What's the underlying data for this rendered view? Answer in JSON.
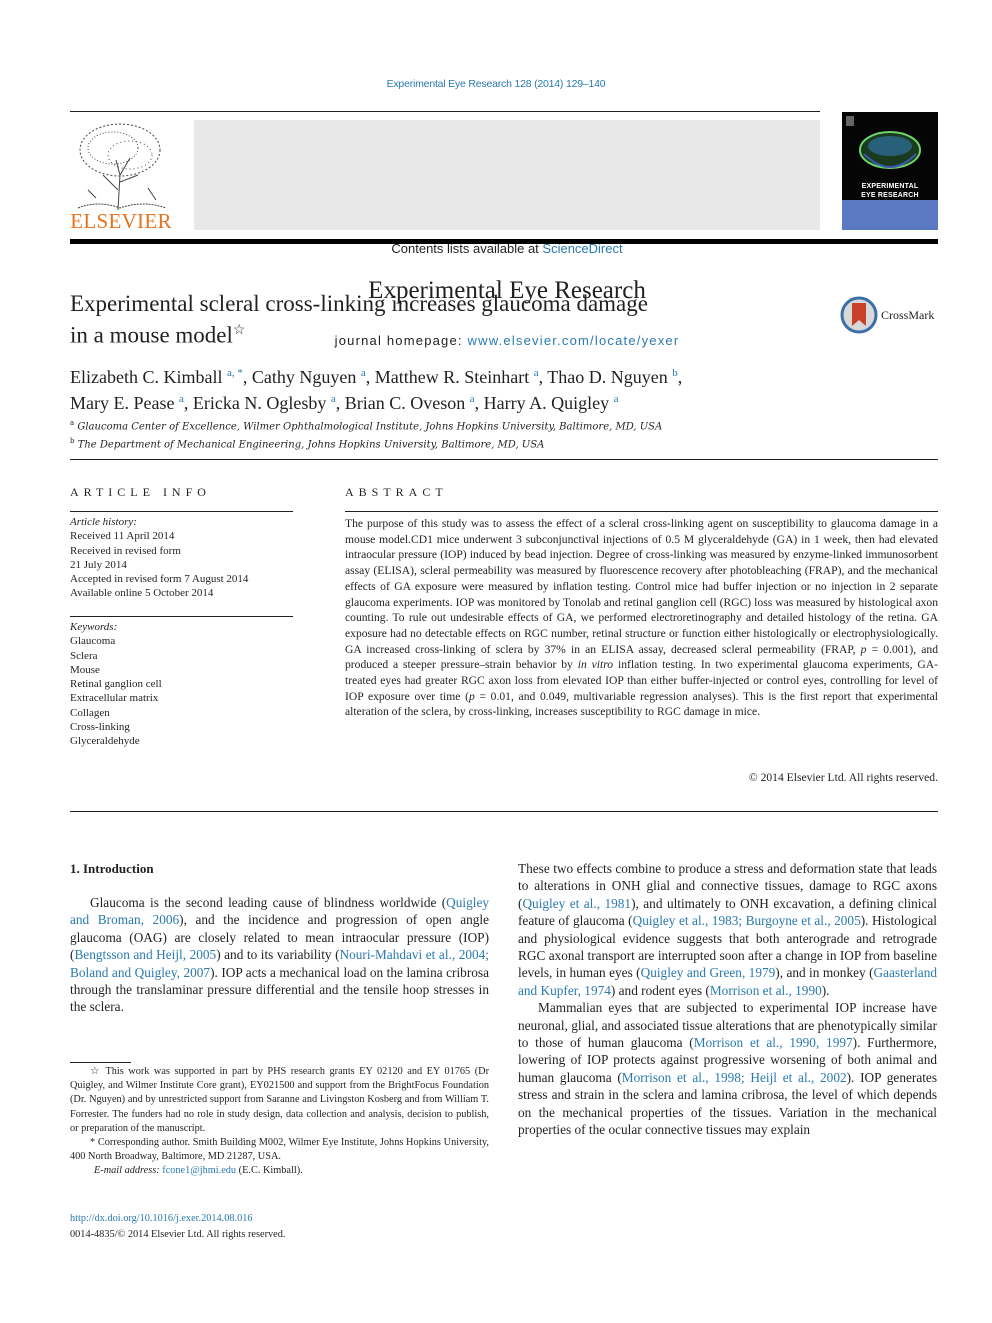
{
  "running_header": "Experimental Eye Research 128 (2014) 129–140",
  "banner": {
    "contents_prefix": "Contents lists available at ",
    "contents_link": "ScienceDirect",
    "journal_name": "Experimental Eye Research",
    "homepage_prefix": "journal homepage: ",
    "homepage_link": "www.elsevier.com/locate/yexer",
    "publisher_logo_text": "ELSEVIER",
    "cover_title_line1": "EXPERIMENTAL",
    "cover_title_line2": "EYE RESEARCH",
    "publisher_color": "#e8731c",
    "link_color": "#2a7ab0"
  },
  "article": {
    "title_line1": "Experimental scleral cross-linking increases glaucoma damage",
    "title_line2": "in a mouse model",
    "title_mark": "☆",
    "crossmark_label": "CrossMark",
    "authors": [
      {
        "name": "Elizabeth C. Kimball",
        "sup": "a, *"
      },
      {
        "name": "Cathy Nguyen",
        "sup": "a"
      },
      {
        "name": "Matthew R. Steinhart",
        "sup": "a"
      },
      {
        "name": "Thao D. Nguyen",
        "sup": "b"
      },
      {
        "name": "Mary E. Pease",
        "sup": "a"
      },
      {
        "name": "Ericka N. Oglesby",
        "sup": "a"
      },
      {
        "name": "Brian C. Oveson",
        "sup": "a"
      },
      {
        "name": "Harry A. Quigley",
        "sup": "a"
      }
    ],
    "affiliations": [
      {
        "mark": "a",
        "text": "Glaucoma Center of Excellence, Wilmer Ophthalmological Institute, Johns Hopkins University, Baltimore, MD, USA"
      },
      {
        "mark": "b",
        "text": "The Department of Mechanical Engineering, Johns Hopkins University, Baltimore, MD, USA"
      }
    ]
  },
  "article_info": {
    "heading": "ARTICLE INFO",
    "history_label": "Article history:",
    "history": [
      "Received 11 April 2014",
      "Received in revised form",
      "21 July 2014",
      "Accepted in revised form 7 August 2014",
      "Available online 5 October 2014"
    ],
    "keywords_label": "Keywords:",
    "keywords": [
      "Glaucoma",
      "Sclera",
      "Mouse",
      "Retinal ganglion cell",
      "Extracellular matrix",
      "Collagen",
      "Cross-linking",
      "Glyceraldehyde"
    ]
  },
  "abstract": {
    "heading": "ABSTRACT",
    "part1": "The purpose of this study was to assess the effect of a scleral cross-linking agent on susceptibility to glaucoma damage in a mouse model.CD1 mice underwent 3 subconjunctival injections of 0.5 M glyceraldehyde (GA) in 1 week, then had elevated intraocular pressure (IOP) induced by bead injection. Degree of cross-linking was measured by enzyme-linked immunosorbent assay (ELISA), scleral permeability was measured by fluorescence recovery after photobleaching (FRAP), and the mechanical effects of GA exposure were measured by inflation testing. Control mice had buffer injection or no injection in 2 separate glaucoma experiments. IOP was monitored by Tonolab and retinal ganglion cell (RGC) loss was measured by histological axon counting. To rule out undesirable effects of GA, we performed electroretinography and detailed histology of the retina. GA exposure had no detectable effects on RGC number, retinal structure or function either histologically or electrophysiologically. GA increased cross-linking of sclera by 37% in an ELISA assay, decreased scleral permeability (FRAP, ",
    "p_symbol": "p",
    "part2": " = 0.001), and produced a steeper pressure–strain behavior by ",
    "in_vitro": "in vitro",
    "part3": " inflation testing. In two experimental glaucoma experiments, GA-treated eyes had greater RGC axon loss from elevated IOP than either buffer-injected or control eyes, controlling for level of IOP exposure over time (",
    "part4": " = 0.01, and 0.049, multivariable regression analyses). This is the first report that experimental alteration of the sclera, by cross-linking, increases susceptibility to RGC damage in mice.",
    "copyright": "© 2014 Elsevier Ltd. All rights reserved."
  },
  "introduction": {
    "heading": "1.  Introduction",
    "para1": [
      {
        "t": "Glaucoma is the second leading cause of blindness worldwide ("
      },
      {
        "t": "Quigley and Broman, 2006",
        "link": true
      },
      {
        "t": "), and the incidence and progression of open angle glaucoma (OAG) are closely related to mean intraocular pressure (IOP) ("
      },
      {
        "t": "Bengtsson and Heijl, 2005",
        "link": true
      },
      {
        "t": ") and to its variability ("
      },
      {
        "t": "Nouri-Mahdavi et al., 2004; Boland and Quigley, 2007",
        "link": true
      },
      {
        "t": "). IOP acts a mechanical load on the lamina cribrosa through the translaminar pressure differential and the tensile hoop stresses in the sclera. "
      }
    ],
    "para1_cont": [
      {
        "t": "These two effects combine to produce a stress and deformation state that leads to alterations in ONH glial and connective tissues, damage to RGC axons ("
      },
      {
        "t": "Quigley et al., 1981",
        "link": true
      },
      {
        "t": "), and ultimately to ONH excavation, a defining clinical feature of glaucoma ("
      },
      {
        "t": "Quigley et al., 1983; Burgoyne et al., 2005",
        "link": true
      },
      {
        "t": "). Histological and physiological evidence suggests that both anterograde and retrograde RGC axonal transport are interrupted soon after a change in IOP from baseline levels, in human eyes ("
      },
      {
        "t": "Quigley and Green, 1979",
        "link": true
      },
      {
        "t": "), and in monkey ("
      },
      {
        "t": "Gaasterland and Kupfer, 1974",
        "link": true
      },
      {
        "t": ") and rodent eyes ("
      },
      {
        "t": "Morrison et al., 1990",
        "link": true
      },
      {
        "t": ")."
      }
    ],
    "para2": [
      {
        "t": "Mammalian eyes that are subjected to experimental IOP increase have neuronal, glial, and associated tissue alterations that are phenotypically similar to those of human glaucoma ("
      },
      {
        "t": "Morrison et al., 1990, 1997",
        "link": true
      },
      {
        "t": "). Furthermore, lowering of IOP protects against progressive worsening of both animal and human glaucoma ("
      },
      {
        "t": "Morrison et al., 1998; Heijl et al., 2002",
        "link": true
      },
      {
        "t": "). IOP generates stress and strain in the sclera and lamina cribrosa, the level of which depends on the mechanical properties of the tissues. Variation in the mechanical properties of the ocular connective tissues may explain"
      }
    ]
  },
  "footnotes": {
    "funding_mark": "☆",
    "funding": "This work was supported in part by PHS research grants EY 02120 and EY 01765 (Dr Quigley, and Wilmer Institute Core grant), EY021500 and support from the BrightFocus Foundation (Dr. Nguyen) and by unrestricted support from Saranne and Livingston Kosberg and from William T. Forrester. The funders had no role in study design, data collection and analysis, decision to publish, or preparation of the manuscript.",
    "corresponding_mark": "*",
    "corresponding": "Corresponding author. Smith Building M002, Wilmer Eye Institute, Johns Hopkins University, 400 North Broadway, Baltimore, MD 21287, USA.",
    "email_label": "E-mail address: ",
    "email": "fcone1@jhmi.edu",
    "email_suffix": " (E.C. Kimball).",
    "doi": "http://dx.doi.org/10.1016/j.exer.2014.08.016",
    "issn": "0014-4835/© 2014 Elsevier Ltd. All rights reserved."
  }
}
